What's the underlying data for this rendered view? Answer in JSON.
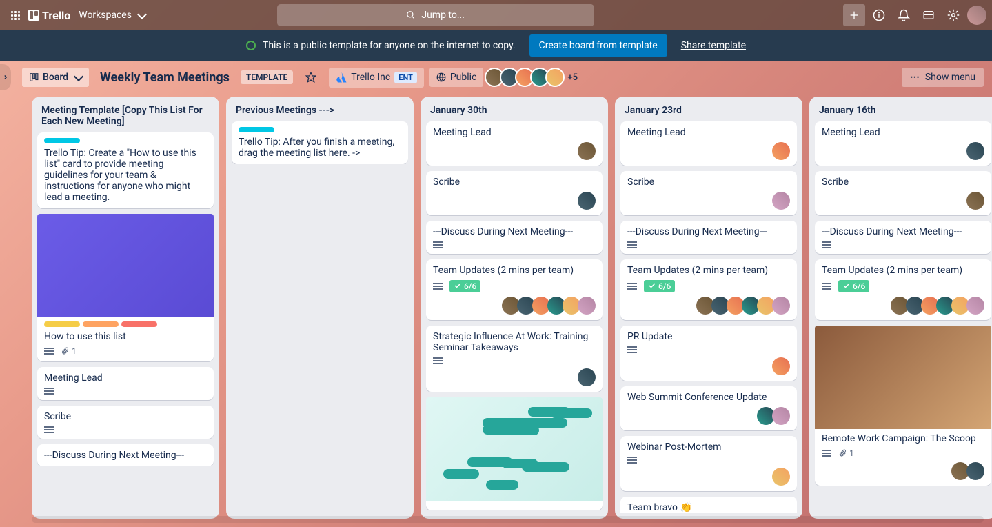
{
  "topbar": {
    "logo": "Trello",
    "workspaces": "Workspaces",
    "search_placeholder": "Jump to..."
  },
  "banner": {
    "text": "This is a public template for anyone on the internet to copy.",
    "create": "Create board from template",
    "share": "Share template"
  },
  "boardbar": {
    "board_btn": "Board",
    "title": "Weekly Team Meetings",
    "template": "TEMPLATE",
    "org": "Trello Inc",
    "ent": "ENT",
    "visibility": "Public",
    "plus_count": "+5",
    "show_menu": "Show menu"
  },
  "lists": [
    {
      "title": "Meeting Template [Copy This List For Each New Meeting]",
      "cards": [
        {
          "labels": [
            "cyan"
          ],
          "text": "Trello Tip: Create a \"How to use this list\" card to provide meeting guidelines for your team & instructions for anyone who might lead a meeting."
        },
        {
          "img": "purple",
          "labels": [
            "yellow",
            "orange",
            "red"
          ],
          "text": "How to use this list",
          "desc": true,
          "attach": "1"
        },
        {
          "text": "Meeting Lead",
          "desc": true
        },
        {
          "text": "Scribe",
          "desc": true
        },
        {
          "text": "---Discuss During Next Meeting---"
        }
      ]
    },
    {
      "title": "Previous Meetings --->",
      "cards": [
        {
          "labels": [
            "cyan"
          ],
          "text": "Trello Tip: After you finish a meeting, drag the meeting list here. ->"
        }
      ]
    },
    {
      "title": "January 30th",
      "cards": [
        {
          "text": "Meeting Lead",
          "avatars": [
            "av1"
          ]
        },
        {
          "text": "Scribe",
          "avatars": [
            "av2"
          ]
        },
        {
          "text": "---Discuss During Next Meeting---",
          "desc": true
        },
        {
          "text": "Team Updates (2 mins per team)",
          "desc": true,
          "check": "6/6",
          "avatars": [
            "av1",
            "av2",
            "av3",
            "av4",
            "av5",
            "av6"
          ]
        },
        {
          "text": "Strategic Influence At Work: Training Seminar Takeaways",
          "desc": true,
          "avatars": [
            "av2"
          ]
        },
        {
          "img": "mindmap"
        }
      ]
    },
    {
      "title": "January 23rd",
      "cards": [
        {
          "text": "Meeting Lead",
          "avatars": [
            "av3"
          ]
        },
        {
          "text": "Scribe",
          "avatars": [
            "av6"
          ]
        },
        {
          "text": "---Discuss During Next Meeting---",
          "desc": true
        },
        {
          "text": "Team Updates (2 mins per team)",
          "desc": true,
          "check": "6/6",
          "avatars": [
            "av1",
            "av2",
            "av3",
            "av4",
            "av5",
            "av6"
          ]
        },
        {
          "text": "PR Update",
          "desc": true,
          "avatars": [
            "av3"
          ]
        },
        {
          "text": "Web Summit Conference Update",
          "avatars": [
            "av4",
            "av6"
          ]
        },
        {
          "text": "Webinar Post-Mortem",
          "desc": true,
          "avatars": [
            "av5"
          ]
        },
        {
          "text": "Team bravo 👏"
        }
      ]
    },
    {
      "title": "January 16th",
      "cards": [
        {
          "text": "Meeting Lead",
          "avatars": [
            "av2"
          ]
        },
        {
          "text": "Scribe",
          "avatars": [
            "av1"
          ]
        },
        {
          "text": "---Discuss During Next Meeting---",
          "desc": true
        },
        {
          "text": "Team Updates (2 mins per team)",
          "desc": true,
          "check": "6/6",
          "avatars": [
            "av1",
            "av2",
            "av3",
            "av4",
            "av5",
            "av6"
          ]
        },
        {
          "img": "cones",
          "text": "Remote Work Campaign: The Scoop",
          "desc": true,
          "attach": "1",
          "avatars": [
            "av1",
            "av2"
          ]
        }
      ]
    }
  ]
}
